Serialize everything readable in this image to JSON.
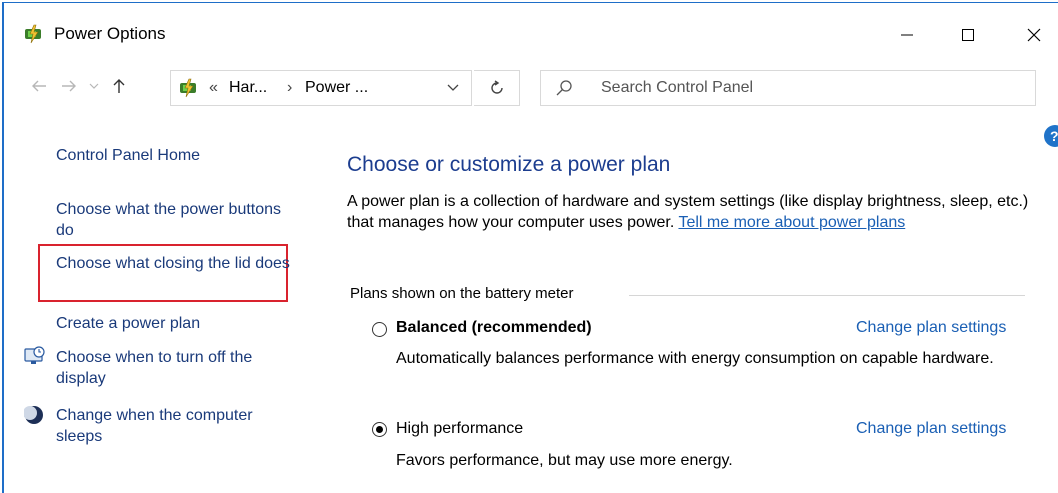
{
  "window": {
    "title": "Power Options",
    "controls": {
      "minimize": "—",
      "maximize": "☐",
      "close": "✕"
    }
  },
  "address": {
    "separator": "«",
    "crumbs": [
      "Har...",
      "Power ..."
    ],
    "crumb_arrow": "›"
  },
  "search": {
    "placeholder": "Search Control Panel"
  },
  "sidebar": {
    "home": "Control Panel Home",
    "links": [
      "Choose what the power buttons do",
      "Choose what closing the lid does",
      "Create a power plan",
      "Choose when to turn off the display",
      "Change when the computer sleeps"
    ]
  },
  "main": {
    "title": "Choose or customize a power plan",
    "description": "A power plan is a collection of hardware and system settings (like display brightness, sleep, etc.) that manages how your computer uses power. ",
    "tell_more_link": "Tell me more about power plans",
    "plans_group_label": "Plans shown on the battery meter",
    "plans": [
      {
        "name": "Balanced (recommended)",
        "selected": false,
        "description": "Automatically balances performance with energy consumption on capable hardware.",
        "change_link": "Change plan settings"
      },
      {
        "name": "High performance",
        "selected": true,
        "description": "Favors performance, but may use more energy.",
        "change_link": "Change plan settings"
      }
    ]
  },
  "help": {
    "label": "?"
  },
  "colors": {
    "accent": "#1f73c9",
    "highlight": "#d9232e",
    "link": "#1a5fb4"
  }
}
